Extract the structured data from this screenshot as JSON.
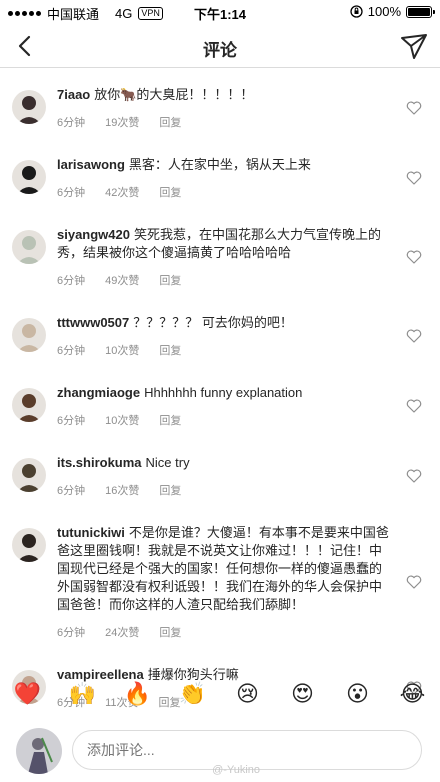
{
  "status_bar": {
    "carrier": "中国联通",
    "network": "4G",
    "vpn": "VPN",
    "time": "下午1:14",
    "battery_percent": "100%",
    "battery_level": 1.0
  },
  "header": {
    "title": "评论"
  },
  "comments": [
    {
      "username": "7iaao",
      "text": "放你🐂的大臭屁！！！！！",
      "time": "6分钟",
      "likes": "19次赞",
      "reply": "回复",
      "avatar_color": "#3a2e2e"
    },
    {
      "username": "larisawong",
      "text": "黑客：人在家中坐，锅从天上来",
      "time": "6分钟",
      "likes": "42次赞",
      "reply": "回复",
      "avatar_color": "#1a1a1a"
    },
    {
      "username": "siyangw420",
      "text": "笑死我惹，在中国花那么大力气宣传晚上的秀，结果被你这个傻逼搞黄了哈哈哈哈哈",
      "time": "6分钟",
      "likes": "49次赞",
      "reply": "回复",
      "avatar_color": "#b9c2b5"
    },
    {
      "username": "tttwww0507",
      "text": "？？？？？ 可去你妈的吧！",
      "time": "6分钟",
      "likes": "10次赞",
      "reply": "回复",
      "avatar_color": "#c9b7a3"
    },
    {
      "username": "zhangmiaoge",
      "text": "Hhhhhhh funny explanation",
      "time": "6分钟",
      "likes": "10次赞",
      "reply": "回复",
      "avatar_color": "#5a3d2b"
    },
    {
      "username": "its.shirokuma",
      "text": "Nice try",
      "time": "6分钟",
      "likes": "16次赞",
      "reply": "回复",
      "avatar_color": "#4b4030"
    },
    {
      "username": "tutunickiwi",
      "text": "不是你是谁？大傻逼！有本事不是要来中国爸爸这里圈钱啊！我就是不说英文让你难过！！！记住！中国现代已经是个强大的国家！任何想你一样的傻逼愚蠢的外国弱智都没有权利诋毁！！我们在海外的华人会保护中国爸爸！而你这样的人渣只配给我们舔脚！",
      "time": "6分钟",
      "likes": "24次赞",
      "reply": "回复",
      "avatar_color": "#2b2420"
    },
    {
      "username": "vampireellena",
      "text": "捶爆你狗头行嘛",
      "time": "6分钟",
      "likes": "11次赞",
      "reply": "回复",
      "avatar_color": "#c2a38f"
    }
  ],
  "emoji_bar": [
    "❤️",
    "🙌",
    "🔥",
    "👏",
    "😢",
    "😍",
    "😮",
    "😂"
  ],
  "input": {
    "placeholder": "添加评论..."
  },
  "watermark": "@-Yukino"
}
